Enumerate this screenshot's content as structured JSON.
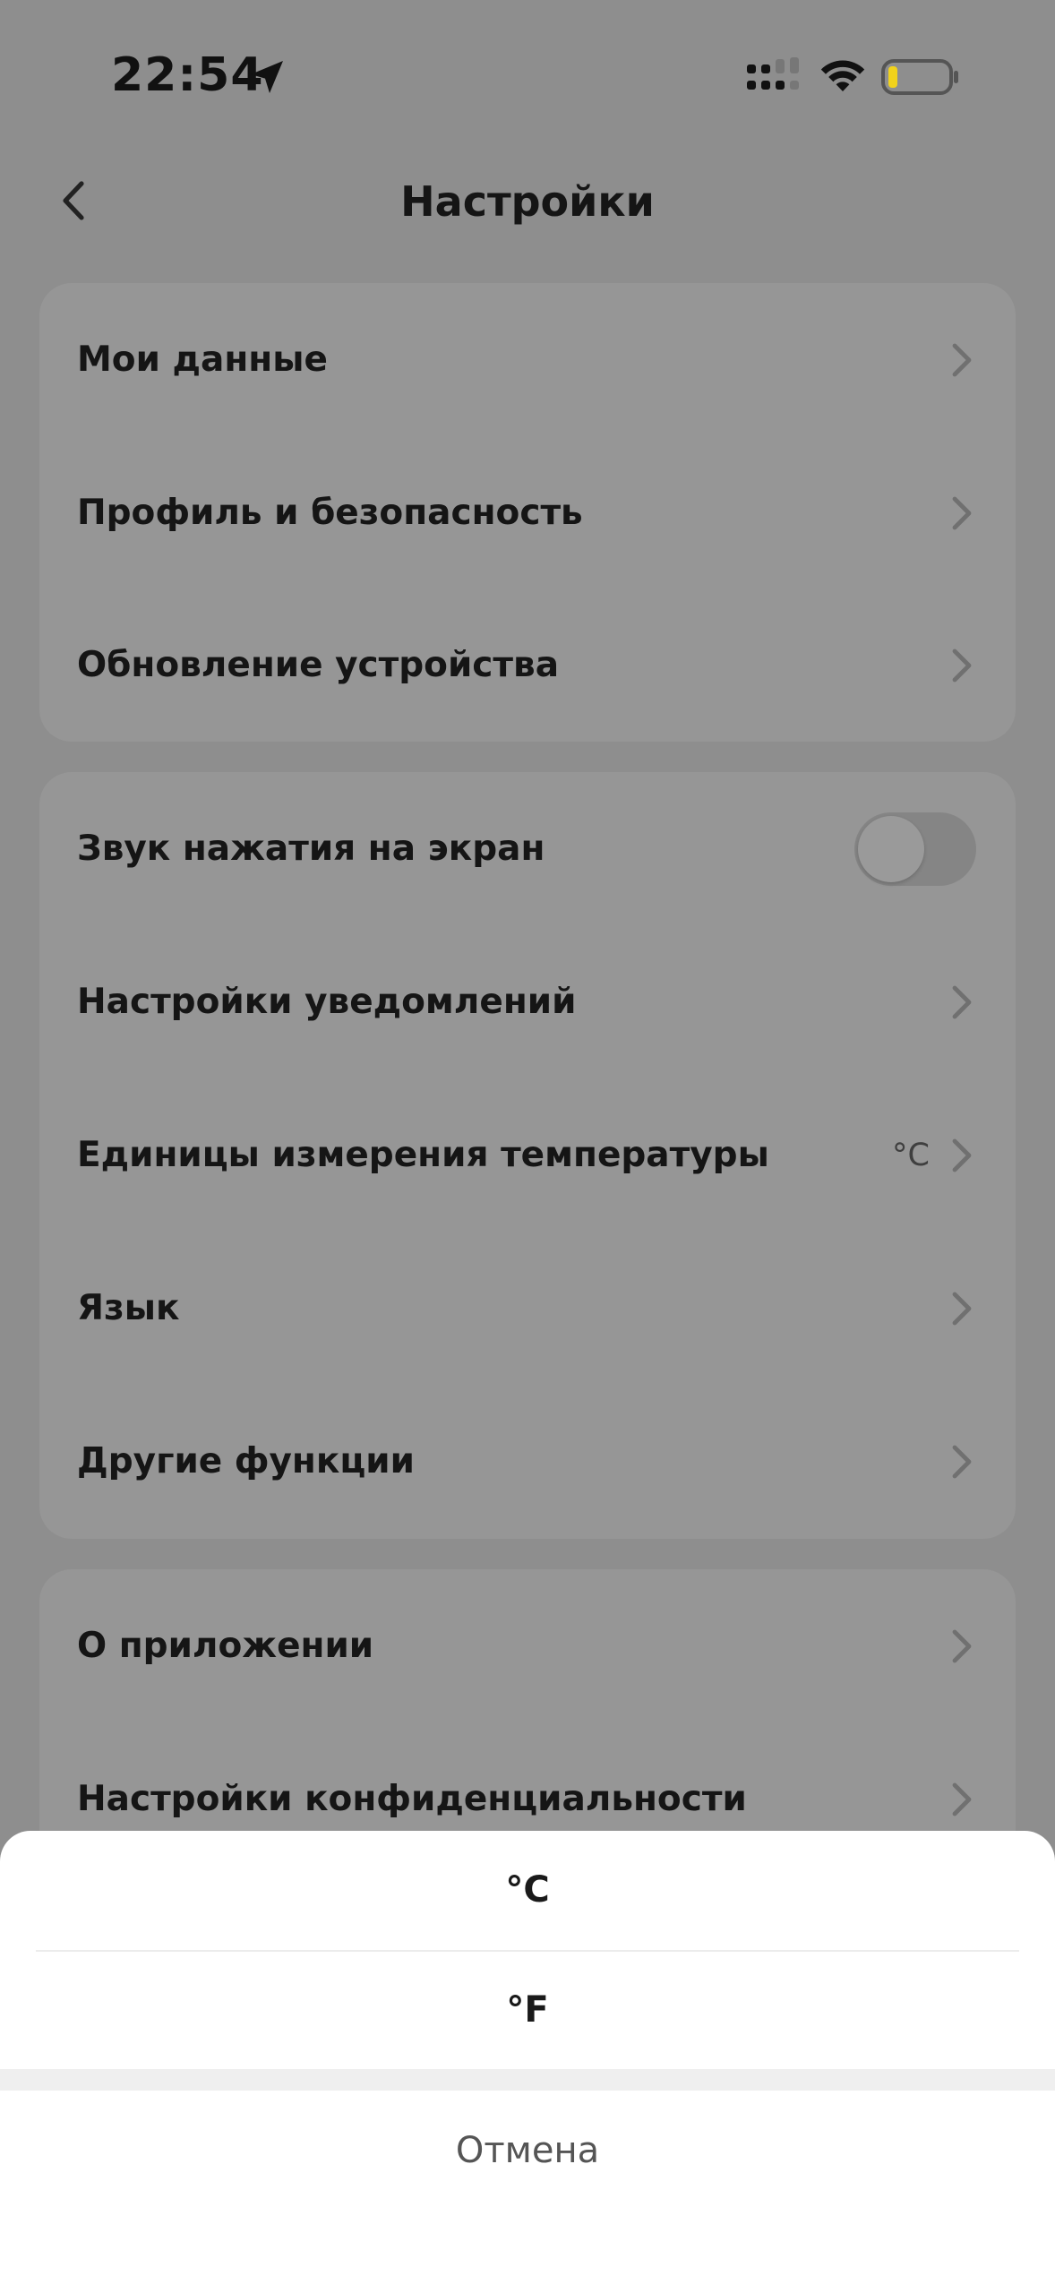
{
  "status_bar": {
    "time": "22:54"
  },
  "header": {
    "title": "Настройки"
  },
  "groups": [
    {
      "rows": [
        {
          "label": "Мои данные"
        },
        {
          "label": "Профиль и безопасность"
        },
        {
          "label": "Обновление устройства"
        }
      ]
    },
    {
      "rows": [
        {
          "label": "Звук нажатия на экран",
          "toggle_on": false
        },
        {
          "label": "Настройки уведомлений"
        },
        {
          "label": "Единицы измерения температуры",
          "value": "°C"
        },
        {
          "label": "Язык"
        },
        {
          "label": "Другие функции"
        }
      ]
    },
    {
      "rows": [
        {
          "label": "О приложении"
        },
        {
          "label": "Настройки конфиденциальности"
        }
      ]
    }
  ],
  "sheet": {
    "options": [
      "°C",
      "°F"
    ],
    "cancel_label": "Отмена"
  },
  "colors": {
    "battery_fill": "#f1d21b",
    "sheet_background": "#ffffff",
    "overlay_background": "#8e8e8e"
  }
}
